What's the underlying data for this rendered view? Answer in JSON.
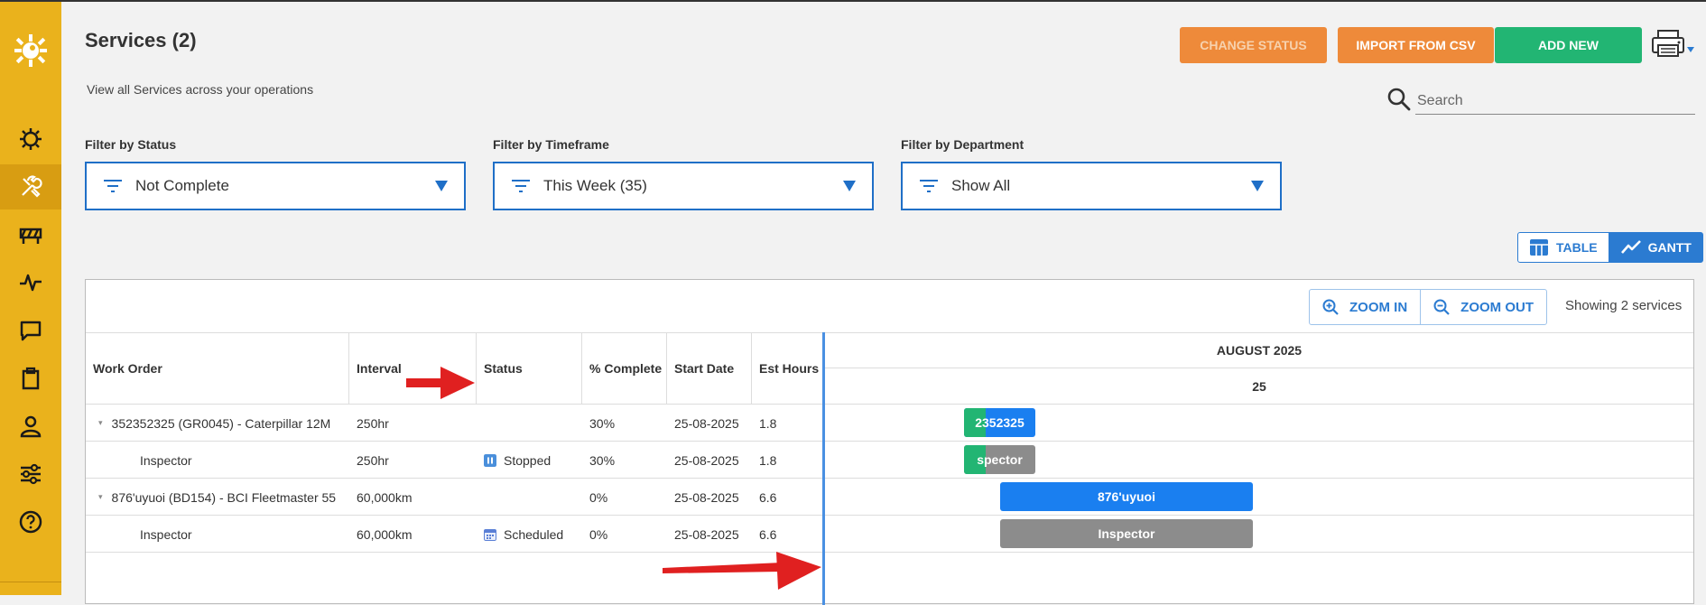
{
  "page": {
    "title": "Services (2)",
    "subtitle": "View all Services across your operations"
  },
  "actions": {
    "change_status": "CHANGE STATUS",
    "import_csv": "IMPORT FROM CSV",
    "add_new": "ADD NEW"
  },
  "search": {
    "placeholder": "Search"
  },
  "filters": {
    "status": {
      "label": "Filter by Status",
      "value": "Not Complete"
    },
    "timeframe": {
      "label": "Filter by Timeframe",
      "value": "This Week (35)"
    },
    "department": {
      "label": "Filter by Department",
      "value": "Show All"
    }
  },
  "view_toggle": {
    "table": "TABLE",
    "gantt": "GANTT",
    "active": "gantt"
  },
  "toolbar": {
    "zoom_in": "ZOOM IN",
    "zoom_out": "ZOOM OUT",
    "showing": "Showing 2 services"
  },
  "grid": {
    "columns": [
      "Work Order",
      "Interval",
      "Status",
      "% Complete",
      "Start Date",
      "Est Hours"
    ],
    "rows": [
      {
        "work_order": "352352325 (GR0045) - Caterpillar 12M",
        "interval": "250hr",
        "status": "",
        "complete": "30%",
        "start": "25-08-2025",
        "hours": "1.8",
        "level": 0
      },
      {
        "work_order": "Inspector",
        "interval": "250hr",
        "status": "Stopped",
        "complete": "30%",
        "start": "25-08-2025",
        "hours": "1.8",
        "level": 1
      },
      {
        "work_order": "876'uyuoi (BD154) - BCI Fleetmaster 55",
        "interval": "60,000km",
        "status": "",
        "complete": "0%",
        "start": "25-08-2025",
        "hours": "6.6",
        "level": 0
      },
      {
        "work_order": "Inspector",
        "interval": "60,000km",
        "status": "Scheduled",
        "complete": "0%",
        "start": "25-08-2025",
        "hours": "6.6",
        "level": 1
      }
    ]
  },
  "gantt": {
    "month": "AUGUST 2025",
    "day": "25",
    "bars": [
      {
        "label": "2352325",
        "color": "#1a7ff0",
        "progress": 0.3
      },
      {
        "label": "spector",
        "color": "#8c8c8c",
        "progress": 0.3
      },
      {
        "label": "876'uyuoi",
        "color": "#1a7ff0",
        "progress": 0
      },
      {
        "label": "Inspector",
        "color": "#8c8c8c",
        "progress": 0
      }
    ]
  },
  "colors": {
    "sidebar": "#eab21c",
    "accent": "#2b7bd1",
    "orange": "#ee8a3a",
    "green": "#22b573",
    "annotation": "#e02020"
  }
}
